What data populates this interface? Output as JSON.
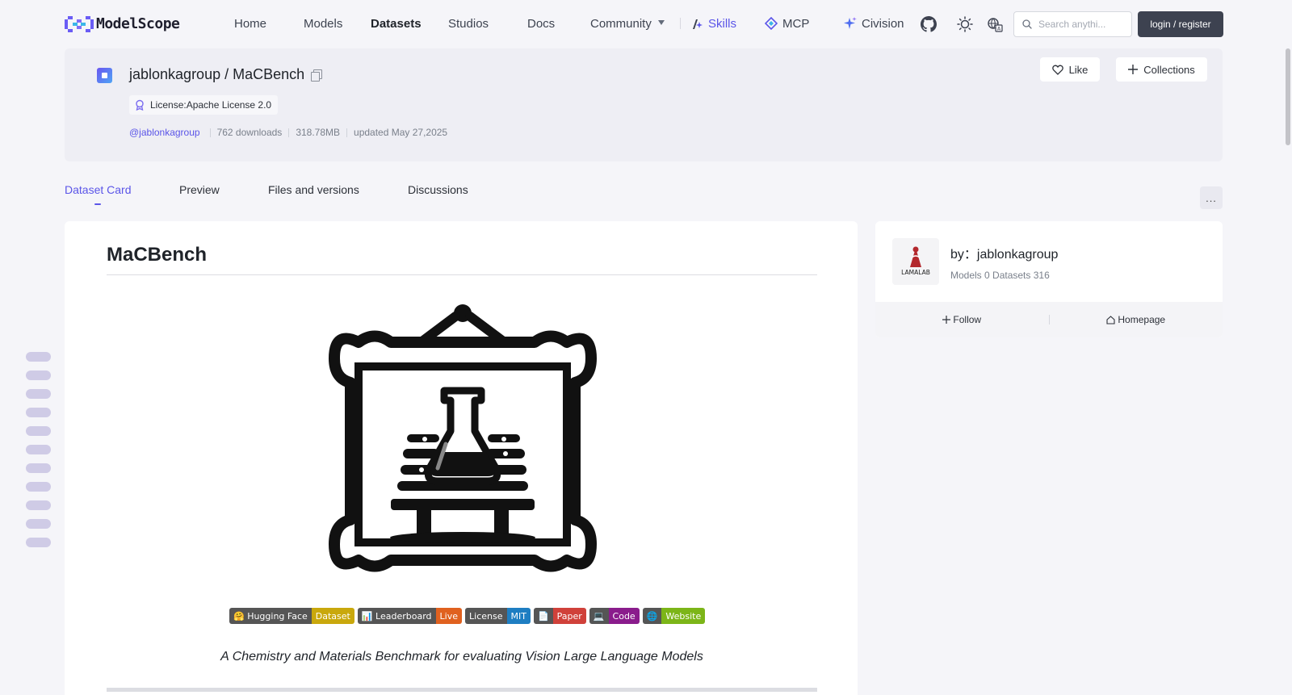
{
  "nav": {
    "logo_text": "ModelScope",
    "links": [
      "Home",
      "Models",
      "Datasets",
      "Studios",
      "Docs"
    ],
    "community": "Community",
    "skills": "Skills",
    "mcp": "MCP",
    "civision": "Civision",
    "search_placeholder": "Search anythi...",
    "login": "login / register",
    "icons": [
      "github-icon",
      "theme-icon",
      "language-icon"
    ]
  },
  "dataset": {
    "owner": "jablonkagroup",
    "name": "MaCBench",
    "license": "License:Apache License 2.0",
    "owner_handle": "@jablonkagroup",
    "downloads": "762 downloads",
    "size": "318.78MB",
    "updated": "updated May 27,2025",
    "like": "Like",
    "collections": "Collections"
  },
  "tabs": [
    "Dataset Card",
    "Preview",
    "Files and versions",
    "Discussions"
  ],
  "tab_more": "...",
  "card": {
    "title": "MaCBench",
    "shields": [
      {
        "left": "🤗 Hugging Face",
        "right": "Dataset",
        "color": "#c9a80c"
      },
      {
        "left": "📊 Leaderboard",
        "right": "Live",
        "color": "#e0611f"
      },
      {
        "left": "License",
        "right": "MIT",
        "color": "#1e7ec2"
      },
      {
        "left": "📄",
        "right": "Paper",
        "color": "#d0413a"
      },
      {
        "left": "💻",
        "right": "Code",
        "color": "#8a1c8c"
      },
      {
        "left": "🌐",
        "right": "Website",
        "color": "#7cb518"
      }
    ],
    "tagline": "A Chemistry and Materials Benchmark for evaluating Vision Large Language Models"
  },
  "owner_card": {
    "by": "by：jablonkagroup",
    "avatar_text": "LAMALAB",
    "counts": "Models 0  Datasets 316",
    "follow": "Follow",
    "homepage": "Homepage"
  },
  "colors": {
    "accent": "#5b55e8",
    "login_bg": "#3d4250"
  }
}
